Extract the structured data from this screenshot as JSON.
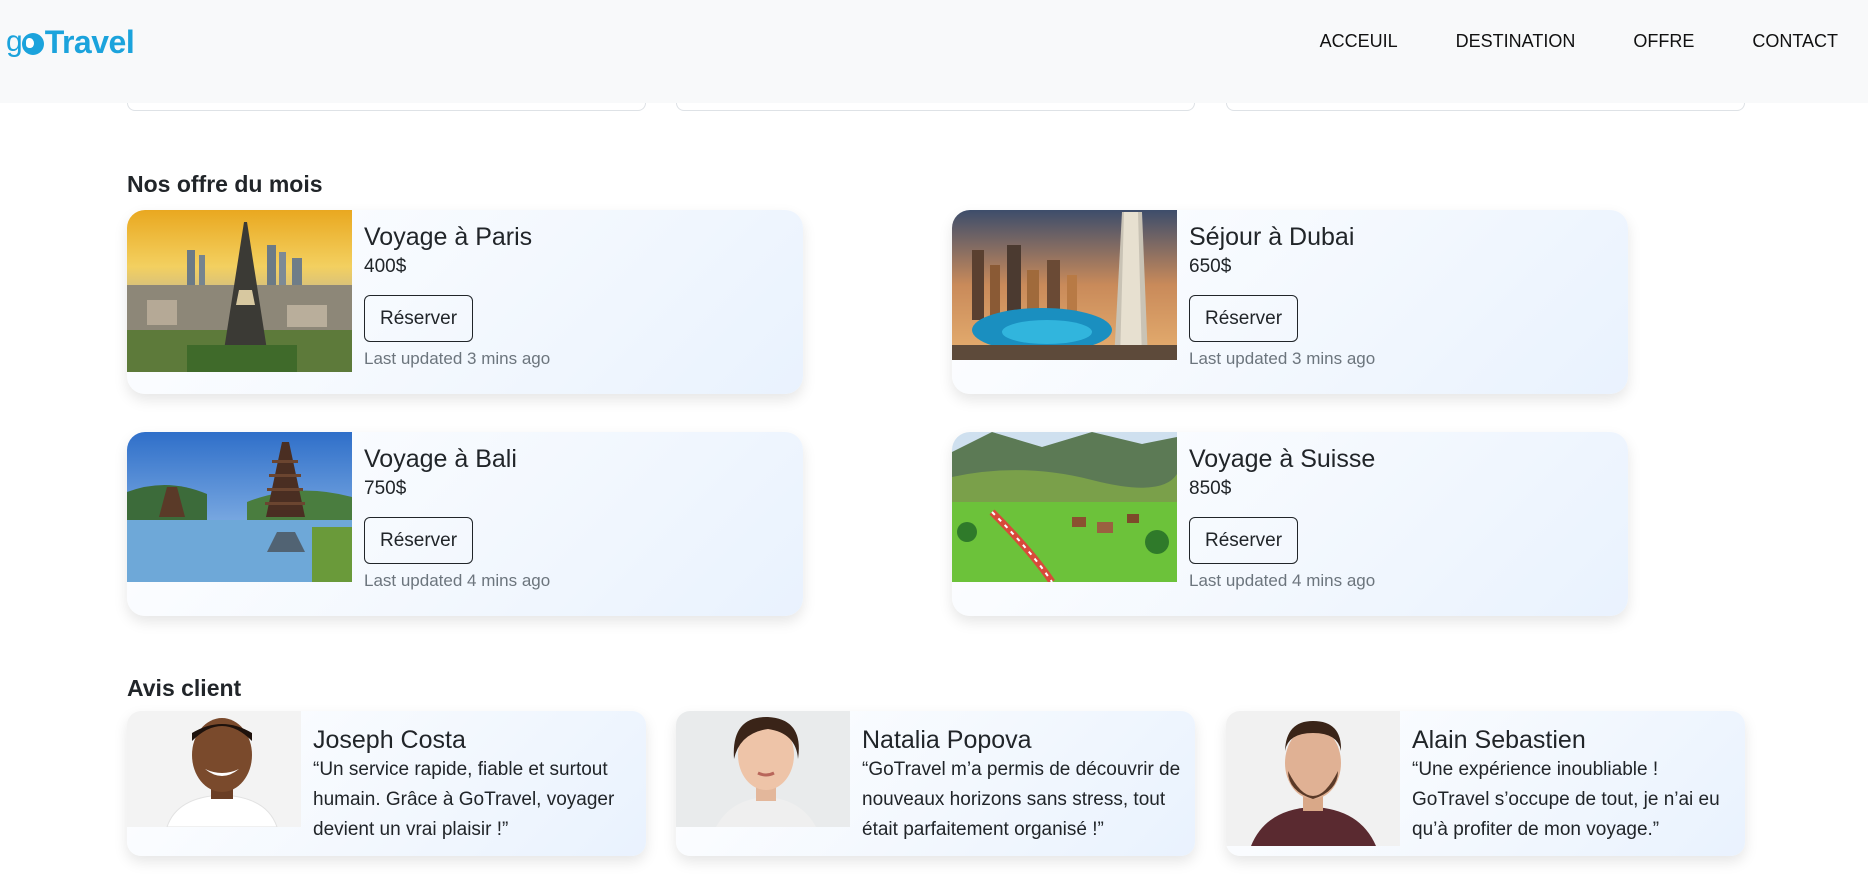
{
  "brand": {
    "logo_text": "goTravel",
    "color": "#1ba3dc"
  },
  "nav": {
    "items": [
      {
        "label": "ACCEUIL"
      },
      {
        "label": "DESTINATION"
      },
      {
        "label": "OFFRE"
      },
      {
        "label": "CONTACT"
      }
    ]
  },
  "offers": {
    "title": "Nos offre du mois",
    "items": [
      {
        "title": "Voyage à Paris",
        "price": "400$",
        "button": "Réserver",
        "updated": "Last updated 3 mins ago",
        "image": "paris-eiffel-tower-photo"
      },
      {
        "title": "Séjour à Dubai",
        "price": "650$",
        "button": "Réserver",
        "updated": "Last updated 3 mins ago",
        "image": "dubai-marina-photo"
      },
      {
        "title": "Voyage à Bali",
        "price": "750$",
        "button": "Réserver",
        "updated": "Last updated 4 mins ago",
        "image": "bali-temple-photo"
      },
      {
        "title": "Voyage à Suisse",
        "price": "850$",
        "button": "Réserver",
        "updated": "Last updated 4 mins ago",
        "image": "swiss-valley-train-photo"
      }
    ]
  },
  "reviews": {
    "title": "Avis client",
    "items": [
      {
        "name": "Joseph Costa",
        "text": "“Un service rapide, fiable et surtout humain. Grâce à GoTravel, voyager devient un vrai plaisir !”",
        "image": "man-smiling-portrait"
      },
      {
        "name": "Natalia Popova",
        "text": "“GoTravel m’a permis de découvrir de nouveaux horizons sans stress, tout était parfaitement organisé !”",
        "image": "woman-portrait"
      },
      {
        "name": "Alain Sebastien",
        "text": "“Une expérience inoubliable ! GoTravel s’occupe de tout, je n’ai eu qu’à profiter de mon voyage.”",
        "image": "bearded-man-portrait"
      }
    ]
  }
}
